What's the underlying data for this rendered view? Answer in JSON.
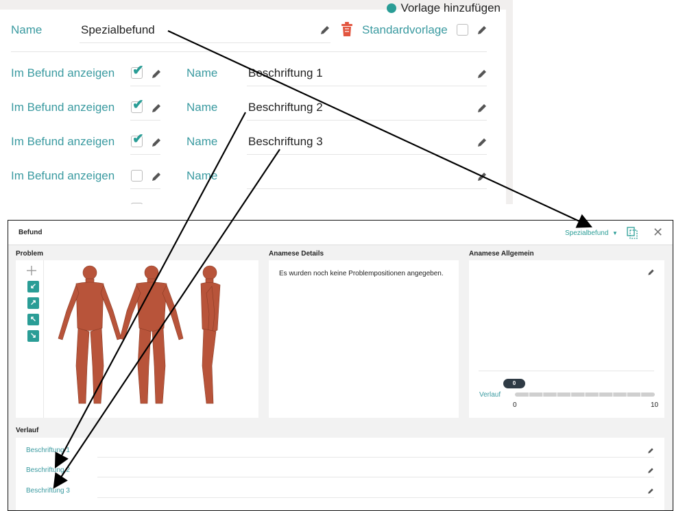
{
  "editor": {
    "add_template_label": "Vorlage hinzufügen",
    "name_label": "Name",
    "name_value": "Spezialbefund",
    "standard_label": "Standardvorlage",
    "rows": [
      {
        "show_label": "Im Befund anzeigen",
        "checked": true,
        "name_label": "Name",
        "name_value": "Beschriftung 1"
      },
      {
        "show_label": "Im Befund anzeigen",
        "checked": true,
        "name_label": "Name",
        "name_value": "Beschriftung 2"
      },
      {
        "show_label": "Im Befund anzeigen",
        "checked": true,
        "name_label": "Name",
        "name_value": "Beschriftung 3"
      },
      {
        "show_label": "Im Befund anzeigen",
        "checked": false,
        "name_label": "Name",
        "name_value": ""
      }
    ]
  },
  "befund": {
    "title": "Befund",
    "template_selector": "Spezialbefund",
    "problem_label": "Problem",
    "anamnese_details_label": "Anamese Details",
    "anamnese_details_empty": "Es wurden noch keine Problempositionen angegeben.",
    "anamnese_allgemein_label": "Anamese Allgemein",
    "slider": {
      "label": "Verlauf",
      "value": "0",
      "min": "0",
      "max": "10"
    },
    "verlauf_label": "Verlauf",
    "verlauf_items": [
      "Beschriftung 1",
      "Beschriftung 2",
      "Beschriftung 3"
    ]
  },
  "colors": {
    "accent": "#2a9d96",
    "label_teal": "#3a9aa0",
    "trash_red": "#e2553f"
  }
}
